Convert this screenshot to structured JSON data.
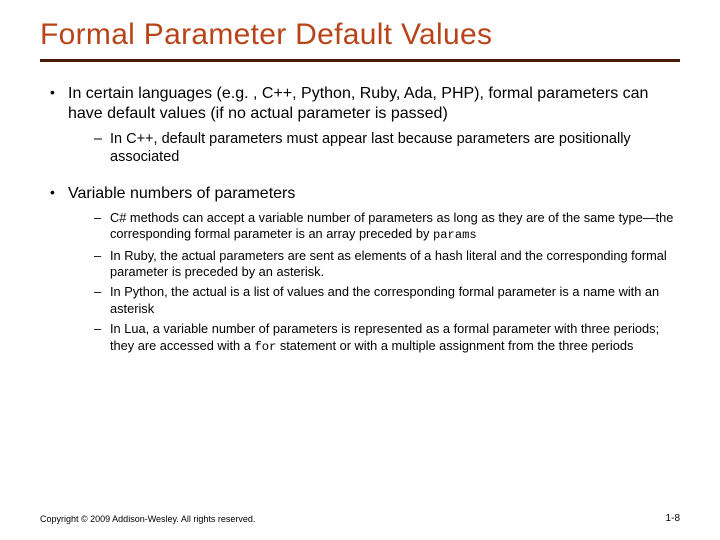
{
  "title": "Formal Parameter Default Values",
  "bullets": {
    "b1": {
      "text": "In certain languages (e.g. , C++, Python, Ruby, Ada, PHP), formal parameters can have default values (if no actual parameter is passed)",
      "sub": {
        "s1": "In C++, default parameters must appear last because parameters are positionally associated"
      }
    },
    "b2": {
      "text": "Variable numbers of parameters",
      "sub": {
        "s1a": "C# methods can accept a variable number of parameters as long as they are of the same type—the corresponding formal parameter is an array preceded by ",
        "s1code": "params",
        "s2": "In Ruby, the actual parameters are sent as elements of a hash literal and the corresponding formal parameter is preceded by an asterisk.",
        "s3": "In Python, the actual is a list of values and the corresponding formal parameter is a name with an asterisk",
        "s4a": "In Lua, a variable number of parameters is represented as a formal parameter with three periods; they are accessed with a ",
        "s4code": "for",
        "s4b": " statement or with a multiple assignment from the three periods"
      }
    }
  },
  "footer": "Copyright © 2009 Addison-Wesley. All rights reserved.",
  "pagenum": "1-8"
}
